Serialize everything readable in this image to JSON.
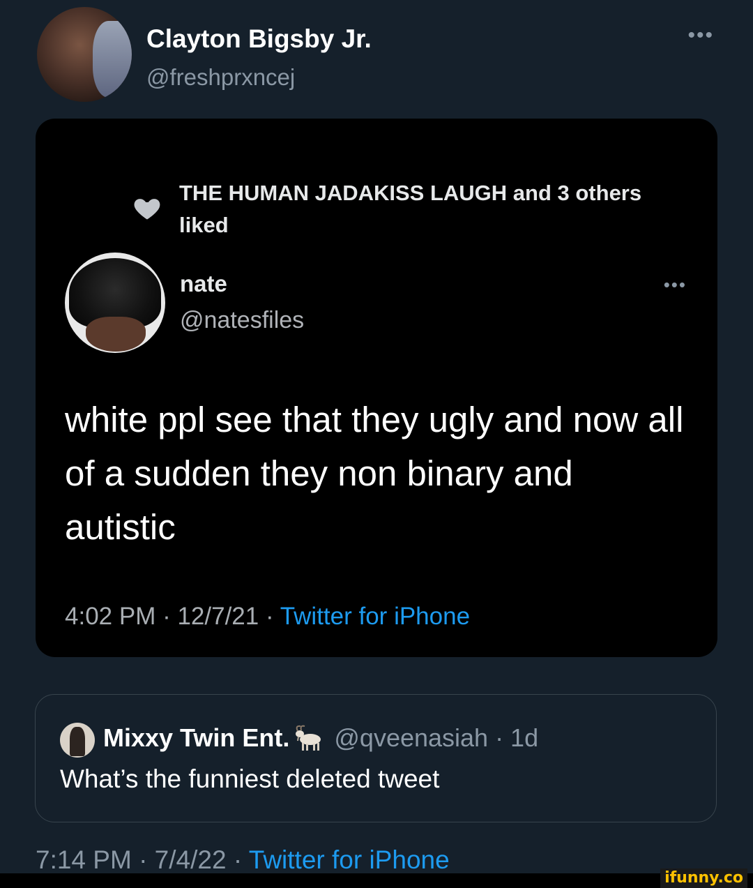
{
  "tweet": {
    "author": {
      "display_name": "Clayton Bigsby Jr.",
      "handle": "@freshprxncej",
      "avatar_icon": "profile-photo"
    },
    "more_label": "•••",
    "footer": {
      "time": "7:14 PM · 7/4/22 · ",
      "source": "Twitter for iPhone"
    }
  },
  "screenshot": {
    "liked_text": "THE HUMAN JADAKISS LAUGH and 3 others liked",
    "heart_icon": "heart-icon",
    "author": {
      "display_name": "nate",
      "handle": "@natesfiles"
    },
    "more_label": "•••",
    "text": "white ppl see that they ugly and now all of a sudden they non binary and autistic",
    "meta": {
      "time": "4:02 PM · 12/7/21 · ",
      "source": "Twitter for iPhone"
    }
  },
  "quote": {
    "display_name": "Mixxy Twin Ent.",
    "emoji_icon": "goat-emoji",
    "handle_time": "@qveenasiah · 1d",
    "text": "What’s the funniest deleted tweet"
  },
  "watermark": "ifunny.co",
  "colors": {
    "background": "#15202b",
    "accent": "#1d9bf0",
    "secondary_text": "#8b98a5"
  }
}
